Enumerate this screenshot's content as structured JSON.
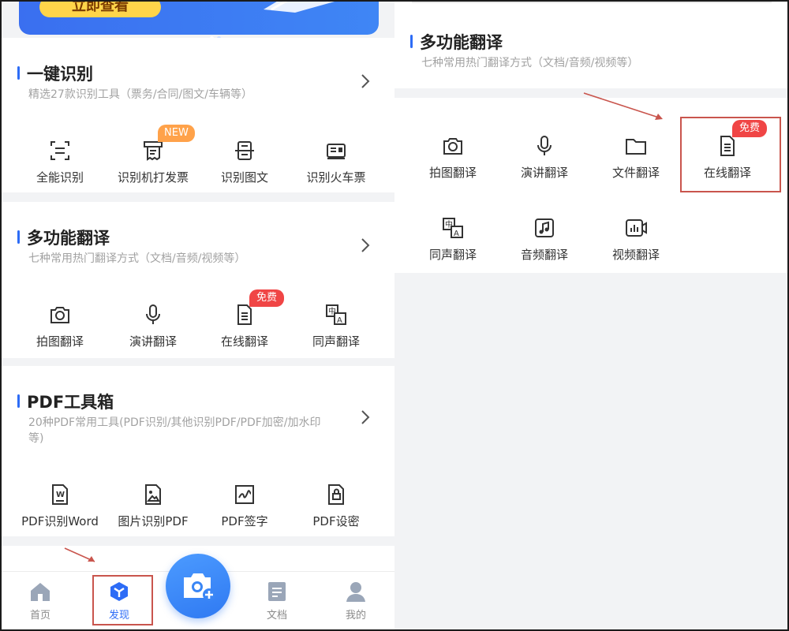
{
  "banner": {
    "button_label": "立即查看"
  },
  "sections": {
    "recognize": {
      "title": "一键识别",
      "subtitle": "精选27款识别工具（票务/合同/图文/车辆等）",
      "items": [
        {
          "label": "全能识别",
          "icon": "scan-icon"
        },
        {
          "label": "识别机打发票",
          "icon": "receipt-icon",
          "badge": "NEW"
        },
        {
          "label": "识别图文",
          "icon": "image-text-scan-icon"
        },
        {
          "label": "识别火车票",
          "icon": "train-ticket-icon"
        }
      ]
    },
    "translate": {
      "title": "多功能翻译",
      "subtitle": "七种常用热门翻译方式（文档/音频/视频等）",
      "items": [
        {
          "label": "拍图翻译",
          "icon": "camera-translate-icon"
        },
        {
          "label": "演讲翻译",
          "icon": "microphone-icon"
        },
        {
          "label": "在线翻译",
          "icon": "document-icon",
          "badge": "免费"
        },
        {
          "label": "同声翻译",
          "icon": "bilingual-icon"
        }
      ]
    },
    "pdf": {
      "title": "PDF工具箱",
      "subtitle_line1": "20种PDF常用工具(PDF识别/其他识别PDF/PDF加密/加水印",
      "subtitle_line2": "等)",
      "items": [
        {
          "label": "PDF识别Word",
          "icon": "word-doc-icon"
        },
        {
          "label": "图片识别PDF",
          "icon": "image-pdf-icon"
        },
        {
          "label": "PDF签字",
          "icon": "signature-icon"
        },
        {
          "label": "PDF设密",
          "icon": "lock-doc-icon"
        }
      ]
    }
  },
  "nav": {
    "items": [
      {
        "label": "首页",
        "icon": "home-icon"
      },
      {
        "label": "发现",
        "icon": "discover-cube-icon",
        "active": true
      },
      {
        "label": "文档",
        "icon": "docs-icon"
      },
      {
        "label": "我的",
        "icon": "profile-icon"
      }
    ],
    "fab_icon": "camera-plus-icon"
  },
  "right_panel": {
    "title": "多功能翻译",
    "subtitle": "七种常用热门翻译方式（文档/音频/视频等）",
    "items": [
      {
        "label": "拍图翻译",
        "icon": "camera-translate-icon"
      },
      {
        "label": "演讲翻译",
        "icon": "microphone-icon"
      },
      {
        "label": "文件翻译",
        "icon": "folder-icon"
      },
      {
        "label": "在线翻译",
        "icon": "document-icon",
        "badge": "免费"
      },
      {
        "label": "同声翻译",
        "icon": "bilingual-icon"
      },
      {
        "label": "音频翻译",
        "icon": "music-note-icon"
      },
      {
        "label": "视频翻译",
        "icon": "video-icon"
      }
    ]
  },
  "colors": {
    "accent": "#2d6cf6",
    "badge_new": "#ffa24a",
    "badge_free": "#f04545",
    "highlight": "#c9554d"
  }
}
